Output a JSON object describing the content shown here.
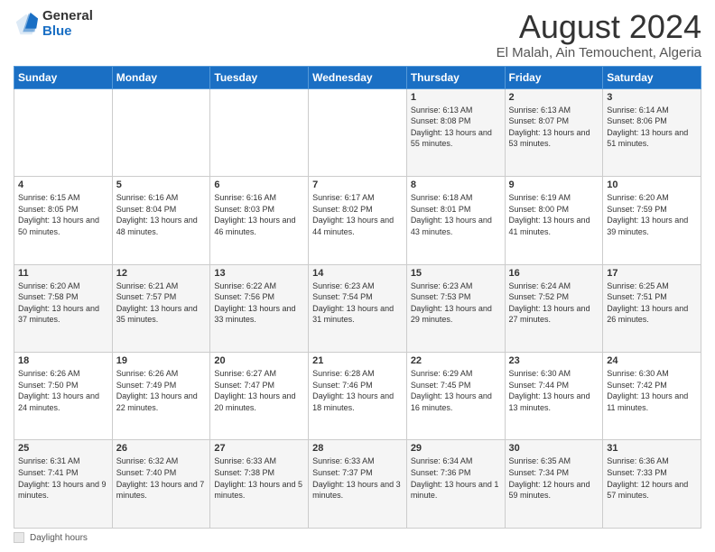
{
  "logo": {
    "general": "General",
    "blue": "Blue"
  },
  "title": "August 2024",
  "subtitle": "El Malah, Ain Temouchent, Algeria",
  "days_header": [
    "Sunday",
    "Monday",
    "Tuesday",
    "Wednesday",
    "Thursday",
    "Friday",
    "Saturday"
  ],
  "weeks": [
    [
      {
        "day": "",
        "info": ""
      },
      {
        "day": "",
        "info": ""
      },
      {
        "day": "",
        "info": ""
      },
      {
        "day": "",
        "info": ""
      },
      {
        "day": "1",
        "info": "Sunrise: 6:13 AM\nSunset: 8:08 PM\nDaylight: 13 hours and 55 minutes."
      },
      {
        "day": "2",
        "info": "Sunrise: 6:13 AM\nSunset: 8:07 PM\nDaylight: 13 hours and 53 minutes."
      },
      {
        "day": "3",
        "info": "Sunrise: 6:14 AM\nSunset: 8:06 PM\nDaylight: 13 hours and 51 minutes."
      }
    ],
    [
      {
        "day": "4",
        "info": "Sunrise: 6:15 AM\nSunset: 8:05 PM\nDaylight: 13 hours and 50 minutes."
      },
      {
        "day": "5",
        "info": "Sunrise: 6:16 AM\nSunset: 8:04 PM\nDaylight: 13 hours and 48 minutes."
      },
      {
        "day": "6",
        "info": "Sunrise: 6:16 AM\nSunset: 8:03 PM\nDaylight: 13 hours and 46 minutes."
      },
      {
        "day": "7",
        "info": "Sunrise: 6:17 AM\nSunset: 8:02 PM\nDaylight: 13 hours and 44 minutes."
      },
      {
        "day": "8",
        "info": "Sunrise: 6:18 AM\nSunset: 8:01 PM\nDaylight: 13 hours and 43 minutes."
      },
      {
        "day": "9",
        "info": "Sunrise: 6:19 AM\nSunset: 8:00 PM\nDaylight: 13 hours and 41 minutes."
      },
      {
        "day": "10",
        "info": "Sunrise: 6:20 AM\nSunset: 7:59 PM\nDaylight: 13 hours and 39 minutes."
      }
    ],
    [
      {
        "day": "11",
        "info": "Sunrise: 6:20 AM\nSunset: 7:58 PM\nDaylight: 13 hours and 37 minutes."
      },
      {
        "day": "12",
        "info": "Sunrise: 6:21 AM\nSunset: 7:57 PM\nDaylight: 13 hours and 35 minutes."
      },
      {
        "day": "13",
        "info": "Sunrise: 6:22 AM\nSunset: 7:56 PM\nDaylight: 13 hours and 33 minutes."
      },
      {
        "day": "14",
        "info": "Sunrise: 6:23 AM\nSunset: 7:54 PM\nDaylight: 13 hours and 31 minutes."
      },
      {
        "day": "15",
        "info": "Sunrise: 6:23 AM\nSunset: 7:53 PM\nDaylight: 13 hours and 29 minutes."
      },
      {
        "day": "16",
        "info": "Sunrise: 6:24 AM\nSunset: 7:52 PM\nDaylight: 13 hours and 27 minutes."
      },
      {
        "day": "17",
        "info": "Sunrise: 6:25 AM\nSunset: 7:51 PM\nDaylight: 13 hours and 26 minutes."
      }
    ],
    [
      {
        "day": "18",
        "info": "Sunrise: 6:26 AM\nSunset: 7:50 PM\nDaylight: 13 hours and 24 minutes."
      },
      {
        "day": "19",
        "info": "Sunrise: 6:26 AM\nSunset: 7:49 PM\nDaylight: 13 hours and 22 minutes."
      },
      {
        "day": "20",
        "info": "Sunrise: 6:27 AM\nSunset: 7:47 PM\nDaylight: 13 hours and 20 minutes."
      },
      {
        "day": "21",
        "info": "Sunrise: 6:28 AM\nSunset: 7:46 PM\nDaylight: 13 hours and 18 minutes."
      },
      {
        "day": "22",
        "info": "Sunrise: 6:29 AM\nSunset: 7:45 PM\nDaylight: 13 hours and 16 minutes."
      },
      {
        "day": "23",
        "info": "Sunrise: 6:30 AM\nSunset: 7:44 PM\nDaylight: 13 hours and 13 minutes."
      },
      {
        "day": "24",
        "info": "Sunrise: 6:30 AM\nSunset: 7:42 PM\nDaylight: 13 hours and 11 minutes."
      }
    ],
    [
      {
        "day": "25",
        "info": "Sunrise: 6:31 AM\nSunset: 7:41 PM\nDaylight: 13 hours and 9 minutes."
      },
      {
        "day": "26",
        "info": "Sunrise: 6:32 AM\nSunset: 7:40 PM\nDaylight: 13 hours and 7 minutes."
      },
      {
        "day": "27",
        "info": "Sunrise: 6:33 AM\nSunset: 7:38 PM\nDaylight: 13 hours and 5 minutes."
      },
      {
        "day": "28",
        "info": "Sunrise: 6:33 AM\nSunset: 7:37 PM\nDaylight: 13 hours and 3 minutes."
      },
      {
        "day": "29",
        "info": "Sunrise: 6:34 AM\nSunset: 7:36 PM\nDaylight: 13 hours and 1 minute."
      },
      {
        "day": "30",
        "info": "Sunrise: 6:35 AM\nSunset: 7:34 PM\nDaylight: 12 hours and 59 minutes."
      },
      {
        "day": "31",
        "info": "Sunrise: 6:36 AM\nSunset: 7:33 PM\nDaylight: 12 hours and 57 minutes."
      }
    ]
  ],
  "footer": {
    "box_label": "Daylight hours"
  }
}
